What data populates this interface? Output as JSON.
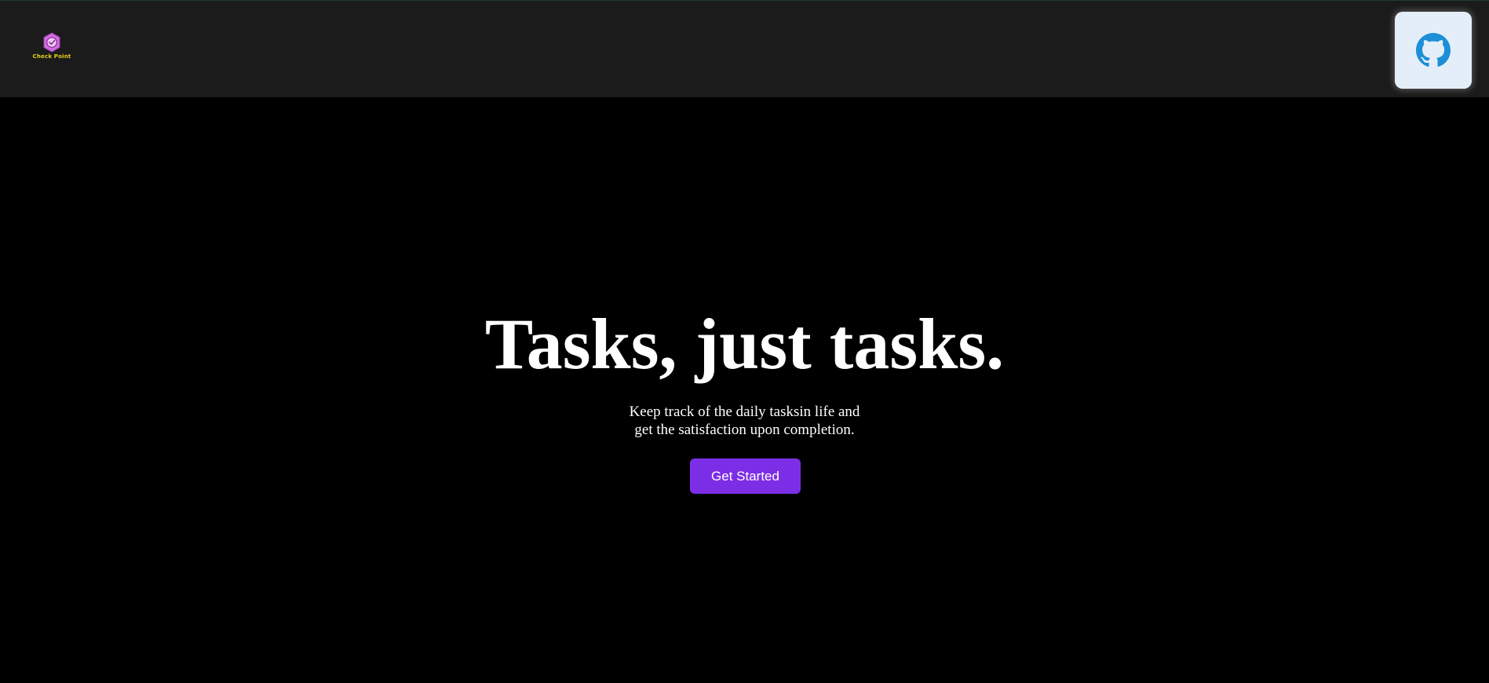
{
  "header": {
    "logo_text": "Check Point",
    "github_icon": "github-icon"
  },
  "hero": {
    "title": "Tasks, just tasks.",
    "subtitle_line1": "Keep track of the daily tasksin life and",
    "subtitle_line2": "get the satisfaction upon completion.",
    "cta_label": "Get Started"
  },
  "colors": {
    "background": "#000000",
    "header_bg": "#1b1b1b",
    "accent": "#7c2ee6",
    "github_btn_bg": "#e4eef8",
    "github_icon": "#1c8fd8",
    "logo_text": "#e6d21a"
  }
}
